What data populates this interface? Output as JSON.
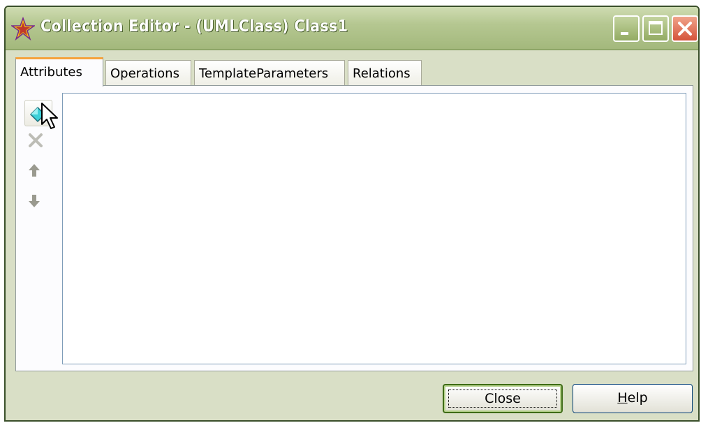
{
  "window": {
    "title": "Collection Editor - (UMLClass) Class1",
    "controls": [
      "minimize-icon",
      "maximize-icon",
      "close-icon"
    ]
  },
  "tabs": [
    {
      "label": "Attributes",
      "active": true
    },
    {
      "label": "Operations",
      "active": false
    },
    {
      "label": "TemplateParameters",
      "active": false
    },
    {
      "label": "Relations",
      "active": false
    }
  ],
  "toolbar": {
    "items": [
      {
        "icon": "add-icon",
        "enabled": true
      },
      {
        "icon": "delete-icon",
        "enabled": false
      },
      {
        "icon": "move-up-icon",
        "enabled": false
      },
      {
        "icon": "move-down-icon",
        "enabled": false
      }
    ]
  },
  "list": {
    "items": []
  },
  "buttons": {
    "close_label": "Close",
    "help_label": "Help",
    "help_mnemonic": "H",
    "help_rest": "elp"
  },
  "colors": {
    "titlebar": "#b5c791",
    "active_tab_accent": "#f5a23a",
    "close_button": "#d5533a"
  }
}
